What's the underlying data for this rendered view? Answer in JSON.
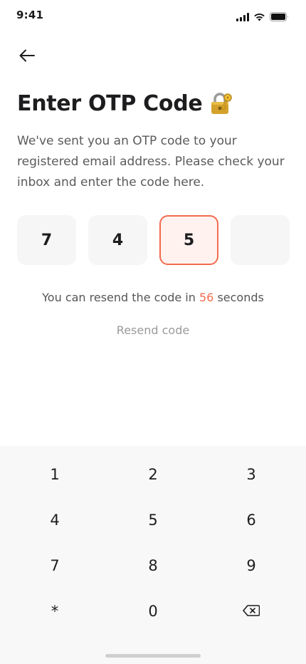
{
  "status_bar": {
    "time": "9:41",
    "icons": [
      "signal-icon",
      "wifi-icon",
      "battery-icon"
    ]
  },
  "header": {
    "back_icon": "arrow-left-icon",
    "title": "Enter OTP Code",
    "title_icon": "lock-with-key-icon"
  },
  "description": "We've sent you an OTP code to your registered email address. Please check your inbox and enter the code here.",
  "otp": {
    "digits": [
      "7",
      "4",
      "5",
      ""
    ],
    "active_index": 2
  },
  "resend": {
    "timer_prefix": "You can resend the code in",
    "seconds": "56",
    "timer_suffix": "seconds",
    "link_label": "Resend code"
  },
  "keypad": {
    "keys": [
      "1",
      "2",
      "3",
      "4",
      "5",
      "6",
      "7",
      "8",
      "9",
      "*",
      "0"
    ],
    "backspace_icon": "backspace-icon"
  },
  "colors": {
    "accent": "#f26b4f",
    "accent_light": "#fff2ef",
    "box_bg": "#f6f6f6",
    "keypad_bg": "#f8f8f8"
  }
}
